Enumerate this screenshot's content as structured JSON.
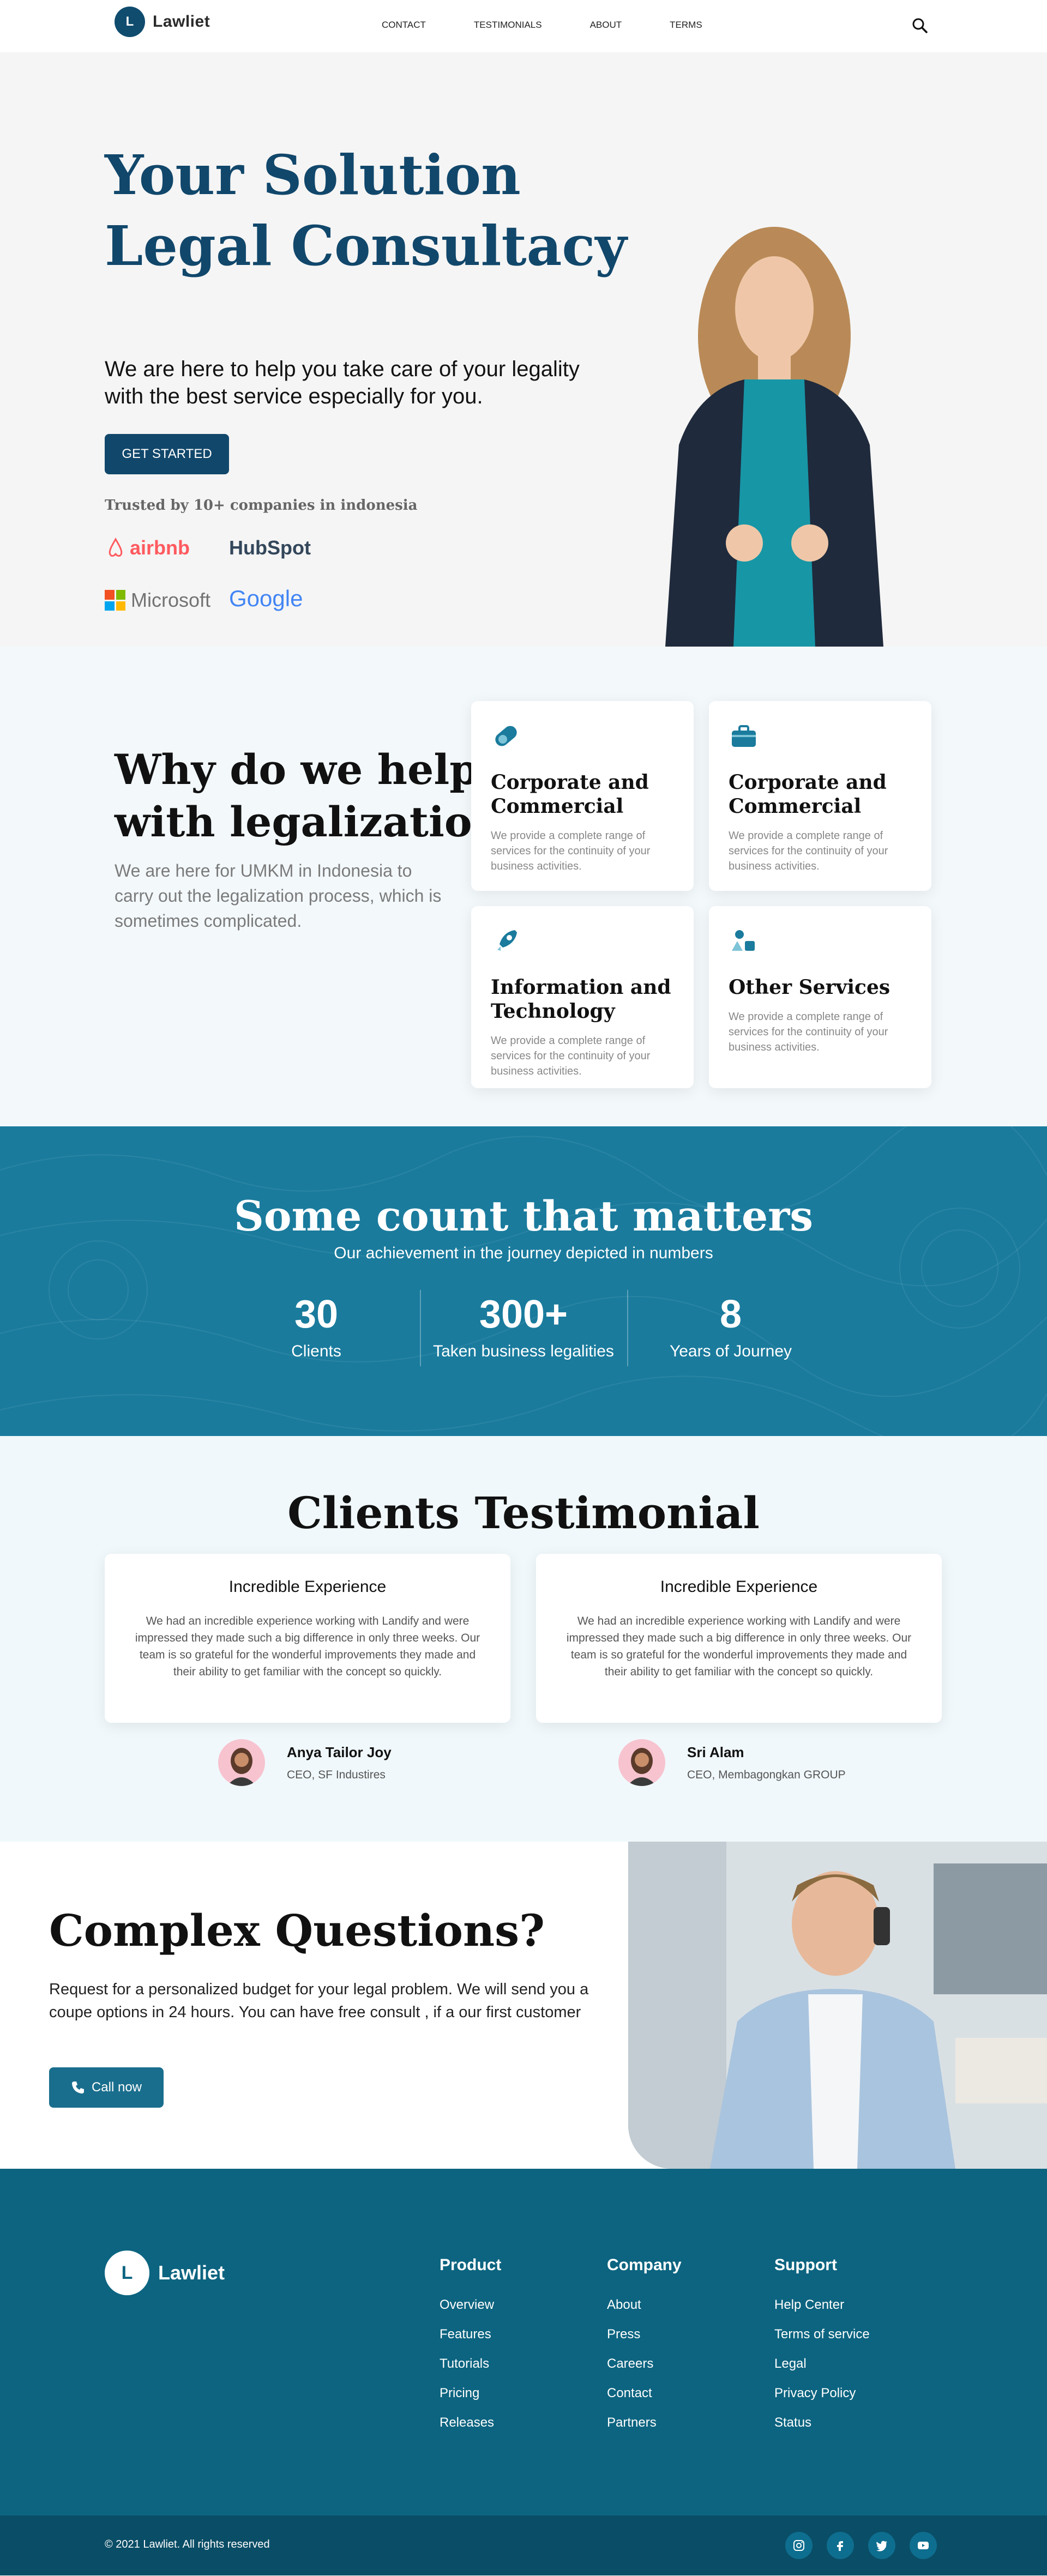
{
  "nav": {
    "logo_letter": "L",
    "brand": "Lawliet",
    "menu": [
      "CONTACT",
      "TESTIMONIALS",
      "ABOUT",
      "TERMS"
    ],
    "search_icon": "search-icon"
  },
  "hero": {
    "title_line1": "Your Solution",
    "title_line2": "Legal Consultacy",
    "subtitle": "We are here to help you take care of your legality with the best service especially for you.",
    "cta": "GET STARTED",
    "trusted": "Trusted by 10+ companies in indonesia",
    "brands": [
      "airbnb",
      "HubSpot",
      "Microsoft",
      "Google"
    ]
  },
  "why": {
    "title_line1": "Why do we help",
    "title_line2": "with legalization?",
    "description": "We are here for UMKM in Indonesia to carry out the legalization process, which is sometimes complicated.",
    "cards": [
      {
        "title": "Corporate and Commercial",
        "text": "We provide a complete range of services for the continuity of your business activities.",
        "icon": "pill-icon"
      },
      {
        "title": "Corporate and Commercial",
        "text": "We provide a complete range of services for the continuity of your business activities.",
        "icon": "briefcase-icon"
      },
      {
        "title": "Information and Technology",
        "text": "We provide a complete range of services for the continuity of your business activities.",
        "icon": "rocket-icon"
      },
      {
        "title": "Other Services",
        "text": "We provide a complete range of services for the continuity of your business activities.",
        "icon": "shapes-icon"
      }
    ]
  },
  "stats": {
    "title": "Some count that matters",
    "subtitle": "Our achievement in the journey depicted in numbers",
    "items": [
      {
        "value": "30",
        "label": "Clients"
      },
      {
        "value": "300+",
        "label": "Taken business legalities"
      },
      {
        "value": "8",
        "label": "Years of Journey"
      }
    ]
  },
  "testimonials": {
    "title": "Clients Testimonial",
    "items": [
      {
        "heading": "Incredible Experience",
        "text": "We had an incredible experience working with Landify and were impressed they made such a big difference in only three weeks. Our team is so grateful for the wonderful improvements they made and their ability to get familiar with the concept so quickly.",
        "name": "Anya Tailor Joy",
        "role": "CEO, SF Industires"
      },
      {
        "heading": "Incredible Experience",
        "text": "We had an incredible experience working with Landify and were impressed they made such a big difference in only three weeks. Our team is so grateful for the wonderful improvements they made and their ability to get familiar with the concept so quickly.",
        "name": "Sri Alam",
        "role": "CEO, Membagongkan GROUP"
      }
    ]
  },
  "questions": {
    "title": "Complex Questions?",
    "description": "Request for a personalized budget for your legal problem. We will send you a coupe options in 24 hours. You can have free consult , if a our first customer",
    "cta": "Call now",
    "cta_icon": "phone-icon"
  },
  "footer": {
    "logo_letter": "L",
    "brand": "Lawliet",
    "columns": [
      {
        "title": "Product",
        "links": [
          "Overview",
          "Features",
          "Tutorials",
          "Pricing",
          "Releases"
        ]
      },
      {
        "title": "Company",
        "links": [
          "About",
          "Press",
          "Careers",
          "Contact",
          "Partners"
        ]
      },
      {
        "title": "Support",
        "links": [
          "Help Center",
          "Terms of service",
          "Legal",
          "Privacy Policy",
          "Status"
        ]
      }
    ],
    "copyright": "© 2021 Lawliet. All rights reserved",
    "socials": [
      "instagram-icon",
      "facebook-icon",
      "twitter-icon",
      "youtube-icon"
    ]
  },
  "colors": {
    "primary": "#11476b",
    "teal": "#1a7b9d",
    "footer": "#0c6480",
    "footer_bottom": "#0a4d66"
  }
}
